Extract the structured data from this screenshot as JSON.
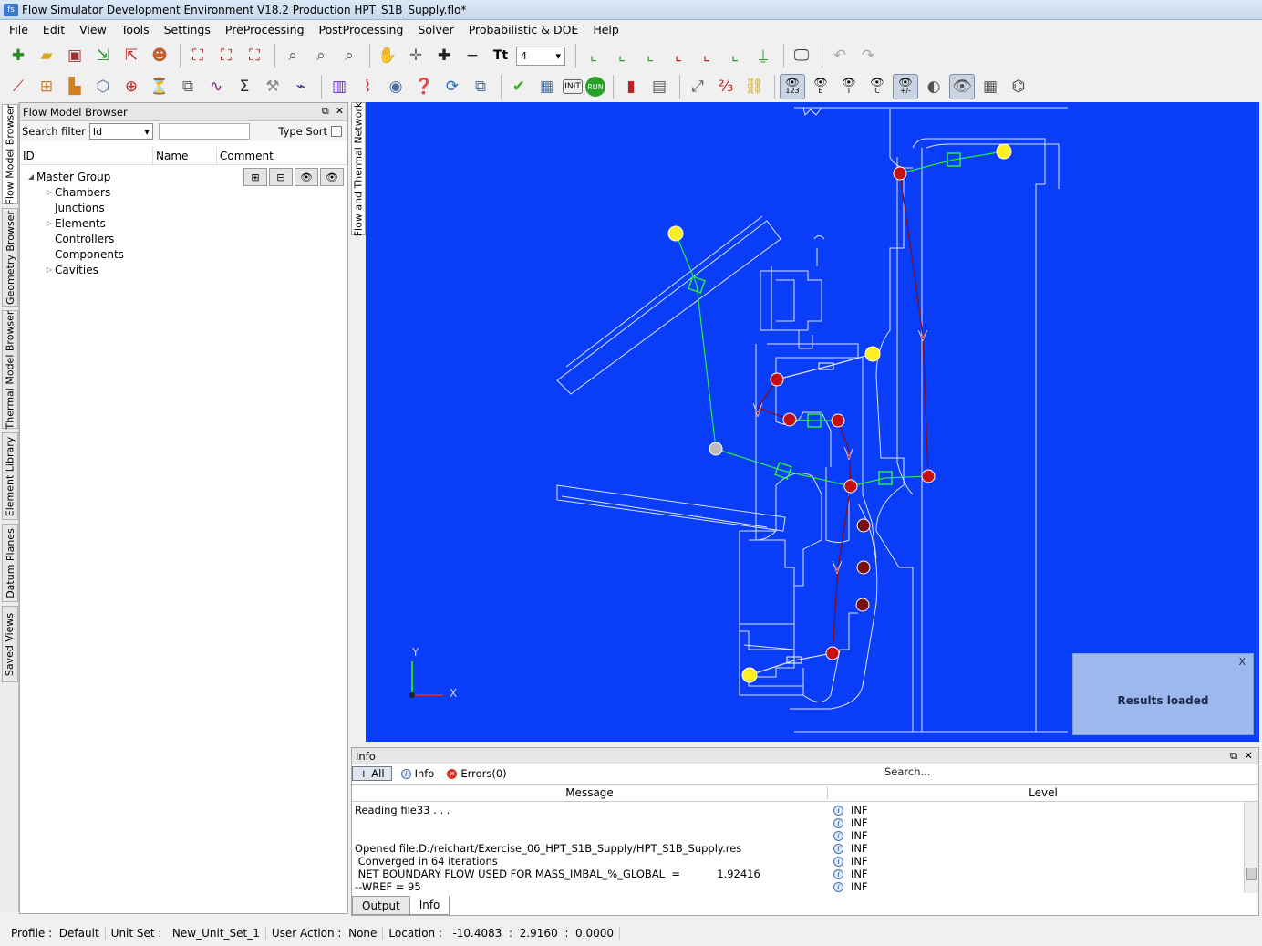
{
  "window": {
    "title": "Flow Simulator Development Environment V18.2 Production HPT_S1B_Supply.flo*"
  },
  "menu": [
    "File",
    "Edit",
    "View",
    "Tools",
    "Settings",
    "PreProcessing",
    "PostProcessing",
    "Solver",
    "Probabilistic & DOE",
    "Help"
  ],
  "toolbar": {
    "font_size_value": "4",
    "eye_labels": [
      "123",
      "E",
      "T",
      "C",
      "+/-"
    ]
  },
  "side_tabs": [
    "Flow Model Browser",
    "Geometry Browser",
    "Thermal Model Browser",
    "Element Library",
    "Datum Planes",
    "Saved Views"
  ],
  "browser": {
    "title": "Flow Model Browser",
    "search_label": "Search filter",
    "filter_value": "Id",
    "type_sort_label": "Type Sort",
    "columns": [
      "ID",
      "Name",
      "Comment"
    ],
    "tree": [
      {
        "label": "Master Group",
        "expanded": true
      },
      {
        "label": "Chambers",
        "has_children": true
      },
      {
        "label": "Junctions",
        "has_children": false
      },
      {
        "label": "Elements",
        "has_children": true
      },
      {
        "label": "Controllers",
        "has_children": false
      },
      {
        "label": "Components",
        "has_children": false
      },
      {
        "label": "Cavities",
        "has_children": true
      }
    ]
  },
  "canvas": {
    "tab_label": "Flow and Thermal Network",
    "axis_y": "Y",
    "axis_x": "X",
    "toast": {
      "text": "Results loaded",
      "close": "X"
    }
  },
  "info": {
    "title": "Info",
    "filters": {
      "all": "All",
      "info": "Info",
      "errors": "Errors(0)"
    },
    "search_placeholder": "Search...",
    "columns": [
      "Message",
      "Level"
    ],
    "rows": [
      {
        "msg": "Reading file33 . . .",
        "lvl": "INF"
      },
      {
        "msg": "",
        "lvl": "INF"
      },
      {
        "msg": "",
        "lvl": "INF"
      },
      {
        "msg": "Opened file:D:/reichart/Exercise_06_HPT_S1B_Supply/HPT_S1B_Supply.res",
        "lvl": "INF"
      },
      {
        "msg": " Converged in 64 iterations",
        "lvl": "INF"
      },
      {
        "msg": " NET BOUNDARY FLOW USED FOR MASS_IMBAL_%_GLOBAL  =           1.92416",
        "lvl": "INF"
      },
      {
        "msg": "--WREF = 95",
        "lvl": "INF"
      }
    ],
    "tabs": [
      "Output",
      "Info"
    ]
  },
  "status": {
    "profile": "Profile :  Default",
    "unit_set": "Unit Set :   New_Unit_Set_1",
    "user_action": "User Action :  None",
    "location": "Location :   -10.4083  :  2.9160  :  0.0000"
  },
  "colors": {
    "canvas_bg": "#0a3df7",
    "node_red": "#c41010",
    "boundary_yellow": "#ffee22",
    "link_green": "#22ee44",
    "link_red": "#8a0a14",
    "geometry_line": "#d8e4ff"
  }
}
